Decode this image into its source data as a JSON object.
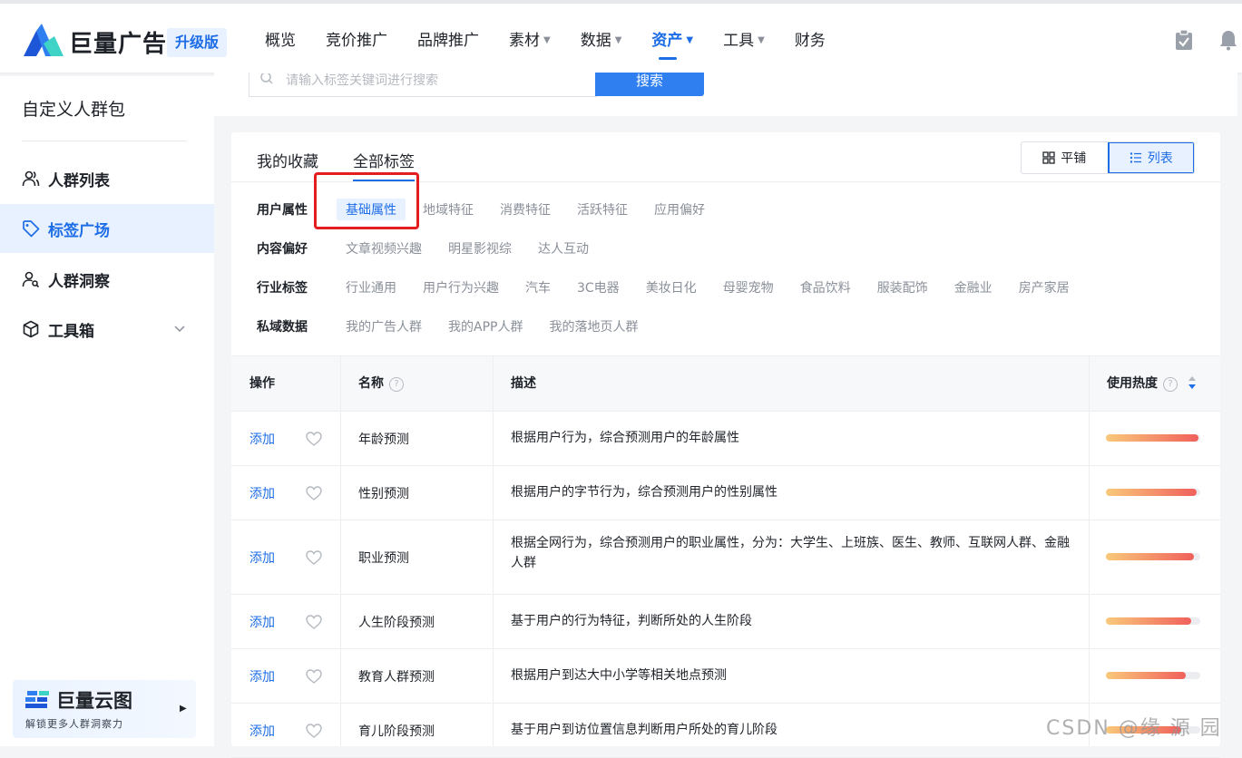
{
  "header": {
    "brand": "巨量广告",
    "badge": "升级版",
    "nav": [
      {
        "label": "概览",
        "caret": false
      },
      {
        "label": "竞价推广",
        "caret": false
      },
      {
        "label": "品牌推广",
        "caret": false
      },
      {
        "label": "素材",
        "caret": true
      },
      {
        "label": "数据",
        "caret": true
      },
      {
        "label": "资产",
        "caret": true,
        "active": true
      },
      {
        "label": "工具",
        "caret": true
      },
      {
        "label": "财务",
        "caret": false
      }
    ]
  },
  "sidebar": {
    "title": "自定义人群包",
    "items": [
      {
        "label": "人群列表",
        "icon": "users-icon"
      },
      {
        "label": "标签广场",
        "icon": "tag-icon",
        "active": true
      },
      {
        "label": "人群洞察",
        "icon": "user-search-icon"
      },
      {
        "label": "工具箱",
        "icon": "cube-icon",
        "expandable": true
      }
    ],
    "promo": {
      "name": "巨量云图",
      "subtitle": "解锁更多人群洞察力"
    }
  },
  "search": {
    "placeholder": "请输入标签关键词进行搜索",
    "button": "搜索"
  },
  "tabs": [
    "我的收藏",
    "全部标签"
  ],
  "active_tab": 1,
  "view_toggle": {
    "tile": "平铺",
    "list": "列表",
    "active": "list"
  },
  "filters": [
    {
      "label": "用户属性",
      "options": [
        "基础属性",
        "地域特征",
        "消费特征",
        "活跃特征",
        "应用偏好"
      ],
      "active": 0
    },
    {
      "label": "内容偏好",
      "options": [
        "文章视频兴趣",
        "明星影视综",
        "达人互动"
      ]
    },
    {
      "label": "行业标签",
      "options": [
        "行业通用",
        "用户行为兴趣",
        "汽车",
        "3C电器",
        "美妆日化",
        "母婴宠物",
        "食品饮料",
        "服装配饰",
        "金融业",
        "房产家居"
      ]
    },
    {
      "label": "私域数据",
      "options": [
        "我的广告人群",
        "我的APP人群",
        "我的落地页人群"
      ]
    }
  ],
  "table": {
    "columns": {
      "action": "操作",
      "name": "名称",
      "desc": "描述",
      "heat": "使用热度"
    },
    "add_label": "添加",
    "rows": [
      {
        "name": "年龄预测",
        "desc": "根据用户行为，综合预测用户的年龄属性",
        "heat": 0.98
      },
      {
        "name": "性别预测",
        "desc": "根据用户的字节行为，综合预测用户的性别属性",
        "heat": 0.96
      },
      {
        "name": "职业预测",
        "desc": "根据全网行为，综合预测用户的职业属性，分为：大学生、上班族、医生、教师、互联网人群、金融人群",
        "heat": 0.93
      },
      {
        "name": "人生阶段预测",
        "desc": "基于用户的行为特征，判断所处的人生阶段",
        "heat": 0.9
      },
      {
        "name": "教育人群预测",
        "desc": "根据用户到达大中小学等相关地点预测",
        "heat": 0.85
      },
      {
        "name": "育儿阶段预测",
        "desc": "基于用户到访位置信息判断用户所处的育儿阶段",
        "heat": 0.8
      }
    ]
  },
  "watermark": "CSDN @缘  源  园",
  "colors": {
    "accent": "#1d6de6",
    "highlight": "#e41e1e"
  }
}
